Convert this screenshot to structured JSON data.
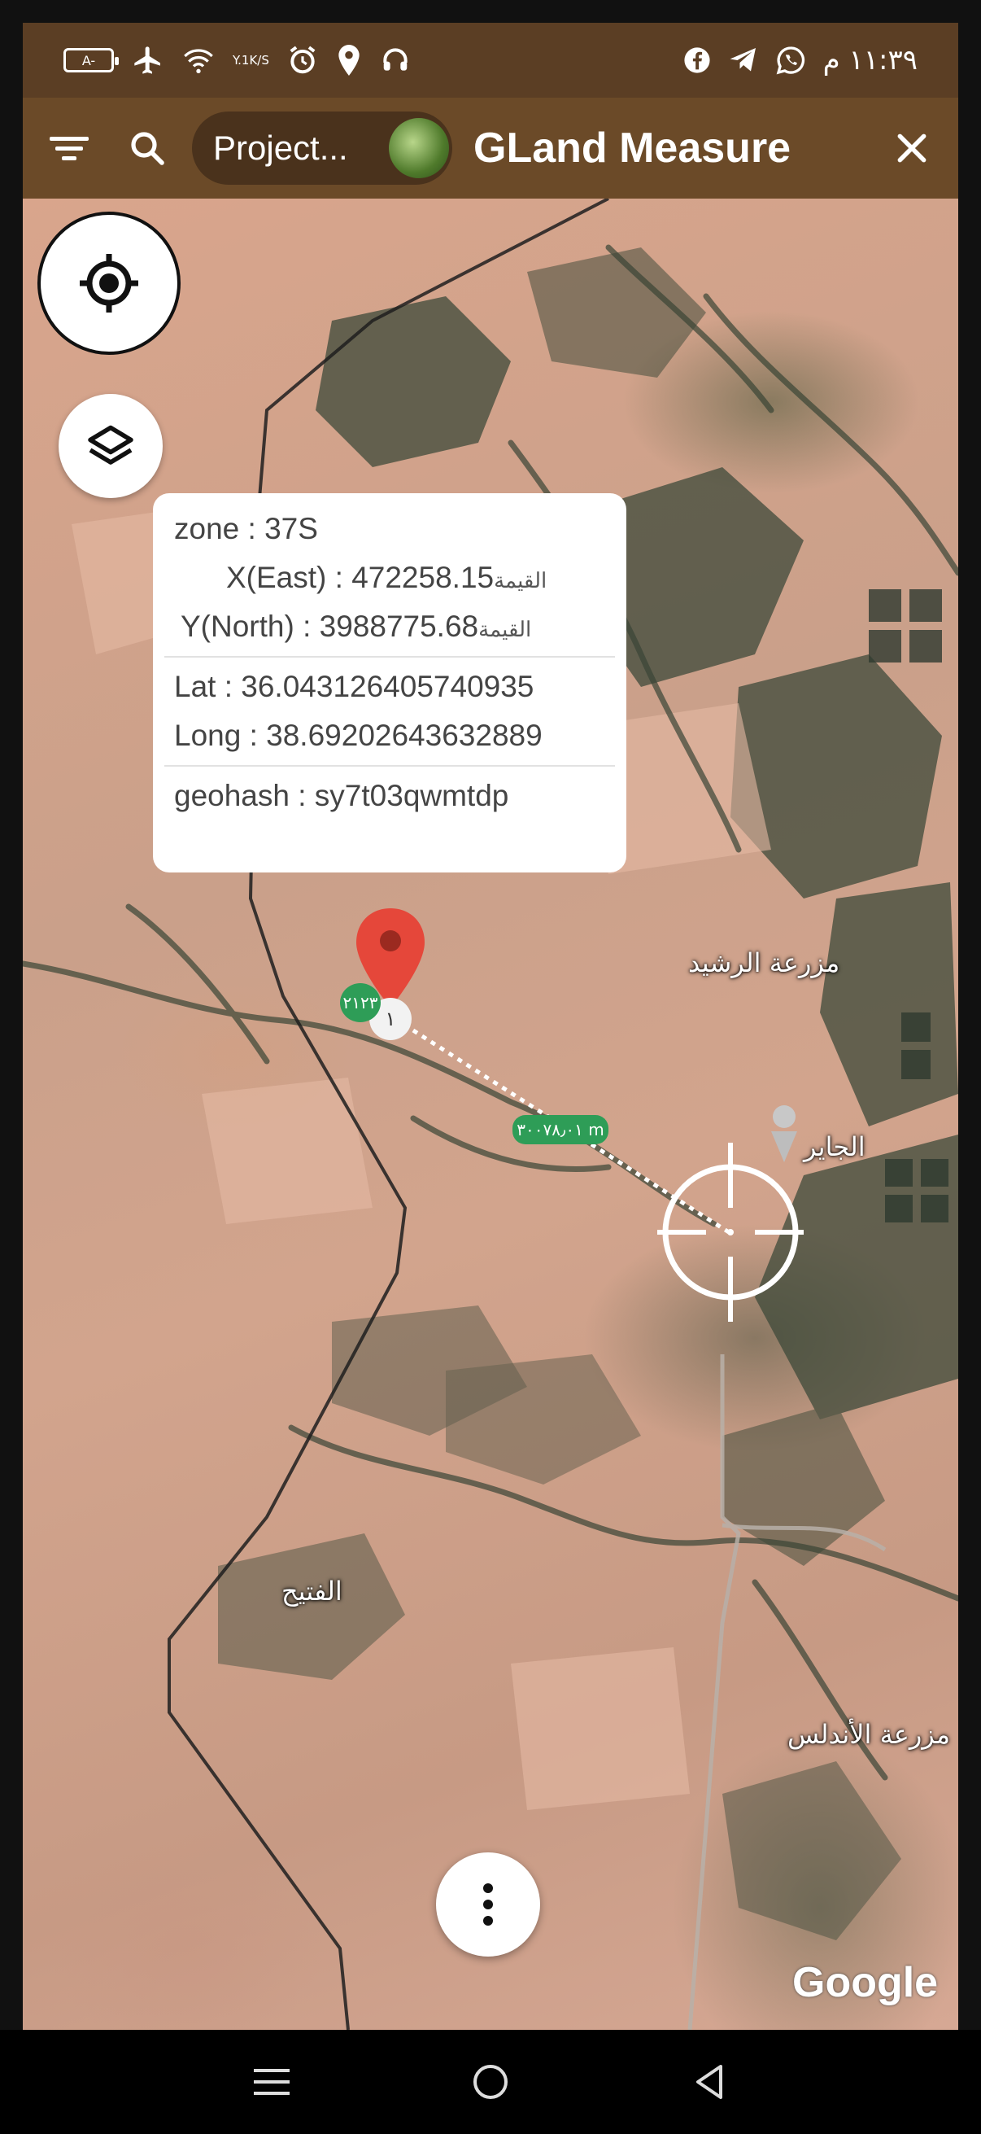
{
  "status_bar": {
    "battery_label": "A-",
    "net_speed_top": "Y.1",
    "net_speed_bottom": "K/S",
    "time": "١١:٣٩ م"
  },
  "app_bar": {
    "project_text": "Project...",
    "title": "GLand Measure"
  },
  "icons": {
    "menu": "filter-menu-icon",
    "search": "search-icon",
    "close": "close-icon",
    "locate": "my-location-icon",
    "layers": "layers-icon",
    "more": "more-vert-icon"
  },
  "info_card": {
    "zone": "zone : 37S",
    "x_east": "X(East) : 472258.15",
    "x_suffix": "القيمة",
    "y_north": "Y(North) : 3988775.68",
    "y_suffix": "القيمة",
    "lat": "Lat : 36.043126405740935",
    "long": "Long : 38.69202643632889",
    "geohash": "geohash : sy7t03qwmtdp"
  },
  "map": {
    "place_labels": [
      "مزرعة الرشيد",
      "الجاير",
      "الفتيح",
      "مزرعة الأندلس"
    ],
    "vertex_label": "١",
    "point_badge": "٢١٢٣",
    "distance_label": "٣٠٠٧٨٫٠١ m",
    "google_logo": "Google"
  },
  "colors": {
    "app_bar": "#6b4a28",
    "status_bar": "#5b3e24",
    "pin_red": "#e5473a",
    "badge_green": "#2e9d57"
  }
}
